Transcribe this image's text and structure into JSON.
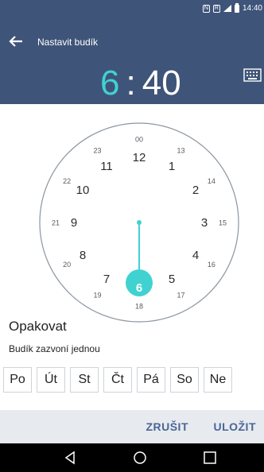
{
  "status_bar": {
    "time": "14:40",
    "nfc": "N",
    "dual": "R"
  },
  "header": {
    "title": "Nastavit budík",
    "hour": "6",
    "colon": ":",
    "minute": "40"
  },
  "dial": {
    "outer_labels": [
      "00",
      "13",
      "14",
      "15",
      "16",
      "17",
      "18",
      "19",
      "20",
      "21",
      "22",
      "23"
    ],
    "inner_labels": [
      "12",
      "1",
      "2",
      "3",
      "4",
      "5",
      "6",
      "7",
      "8",
      "9",
      "10",
      "11"
    ],
    "selected_hour": "6",
    "accent_color": "#40d2d0"
  },
  "repeat": {
    "title": "Opakovat",
    "subtitle": "Budík zazvoní jednou",
    "days": [
      "Po",
      "Út",
      "St",
      "Čt",
      "Pá",
      "So",
      "Ne"
    ]
  },
  "actions": {
    "cancel": "ZRUŠIT",
    "save": "ULOŽIT"
  },
  "colors": {
    "header": "#3f5479",
    "accent": "#40d2d0",
    "action_text": "#4a6696"
  }
}
